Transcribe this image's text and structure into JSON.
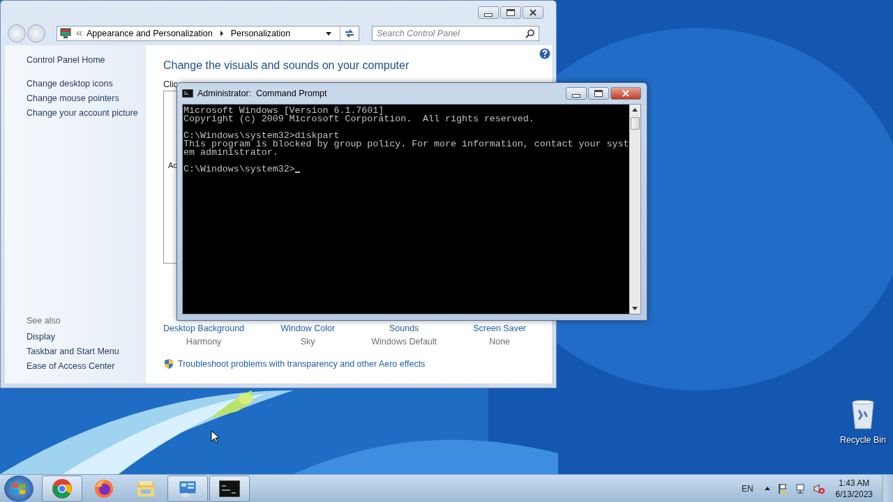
{
  "control_panel": {
    "breadcrumb": [
      {
        "label": "Appearance and Personalization"
      },
      {
        "label": "Personalization"
      }
    ],
    "search": {
      "placeholder": "Search Control Panel"
    },
    "sidebar": {
      "items": [
        {
          "label": "Control Panel Home"
        },
        {
          "label": "Change desktop icons"
        },
        {
          "label": "Change mouse pointers"
        },
        {
          "label": "Change your account picture"
        }
      ],
      "see_also_heading": "See also",
      "see_also": [
        {
          "label": "Display"
        },
        {
          "label": "Taskbar and Start Menu"
        },
        {
          "label": "Ease of Access Center"
        }
      ]
    },
    "heading": "Change the visuals and sounds on your computer",
    "partial_texts": [
      "Clic",
      "Ac"
    ],
    "settings": [
      {
        "label": "Desktop Background",
        "value": "Harmony"
      },
      {
        "label": "Window Color",
        "value": "Sky"
      },
      {
        "label": "Sounds",
        "value": "Windows Default"
      },
      {
        "label": "Screen Saver",
        "value": "None"
      }
    ],
    "troubleshoot_link": "Troubleshoot problems with transparency and other Aero effects"
  },
  "command_prompt": {
    "title": "Administrator:  Command Prompt",
    "paragraphs": [
      [
        "Microsoft Windows [Version 6.1.7601]",
        "Copyright (c) 2009 Microsoft Corporation.  All rights reserved."
      ],
      [
        "C:\\Windows\\system32>diskpart",
        "This program is blocked by group policy. For more information, contact your syst",
        "em administrator."
      ],
      [
        "C:\\Windows\\system32>"
      ]
    ]
  },
  "desktop_icons": [
    {
      "label": "Recycle Bin"
    }
  ],
  "taskbar": {
    "apps": [
      {
        "kind": "chrome",
        "running": true
      },
      {
        "kind": "firefox",
        "running": false
      },
      {
        "kind": "explorer",
        "running": false
      },
      {
        "kind": "control",
        "running": true
      },
      {
        "kind": "cmd",
        "running": true
      }
    ],
    "language": "EN",
    "time": "1:43 AM",
    "date": "6/13/2023"
  }
}
